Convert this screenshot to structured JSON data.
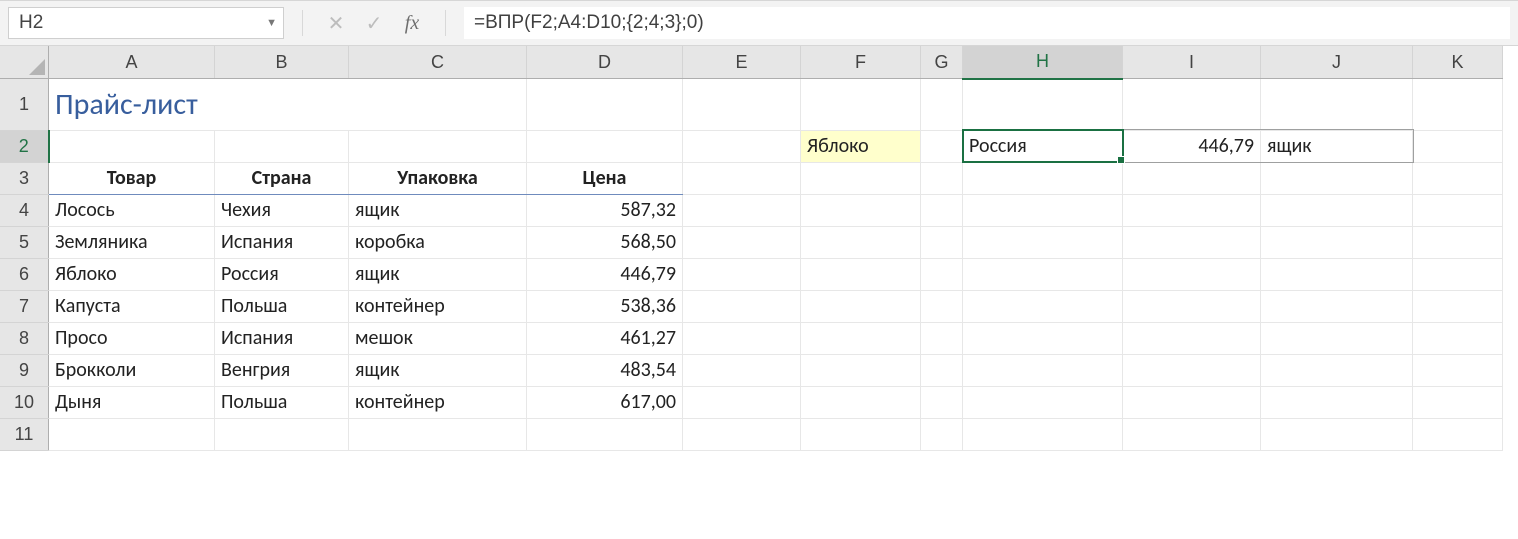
{
  "formula_bar": {
    "name_box": "H2",
    "fx_label": "fx",
    "formula": "=ВПР(F2;A4:D10;{2;4;3};0)"
  },
  "columns": [
    "A",
    "B",
    "C",
    "D",
    "E",
    "F",
    "G",
    "H",
    "I",
    "J",
    "K"
  ],
  "row_numbers": [
    "1",
    "2",
    "3",
    "4",
    "5",
    "6",
    "7",
    "8",
    "9",
    "10",
    "11"
  ],
  "title": "Прайс-лист",
  "headers": {
    "product": "Товар",
    "country": "Страна",
    "pack": "Упаковка",
    "price": "Цена"
  },
  "lookup": {
    "key": "Яблоко",
    "country": "Россия",
    "price": "446,79",
    "pack": "ящик"
  },
  "table_rows": [
    {
      "product": "Лосось",
      "country": "Чехия",
      "pack": "ящик",
      "price": "587,32"
    },
    {
      "product": "Земляника",
      "country": "Испания",
      "pack": "коробка",
      "price": "568,50"
    },
    {
      "product": "Яблоко",
      "country": "Россия",
      "pack": "ящик",
      "price": "446,79"
    },
    {
      "product": "Капуста",
      "country": "Польша",
      "pack": "контейнер",
      "price": "538,36"
    },
    {
      "product": "Просо",
      "country": "Испания",
      "pack": "мешок",
      "price": "461,27"
    },
    {
      "product": "Брокколи",
      "country": "Венгрия",
      "pack": "ящик",
      "price": "483,54"
    },
    {
      "product": "Дыня",
      "country": "Польша",
      "pack": "контейнер",
      "price": "617,00"
    }
  ],
  "active_cell": "H2",
  "selection_range": "H2:J2"
}
